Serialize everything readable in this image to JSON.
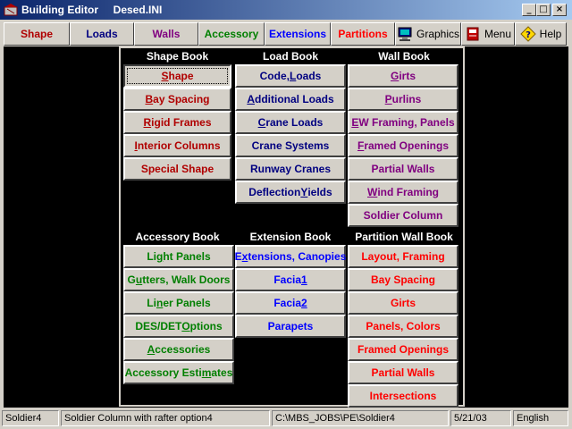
{
  "window": {
    "app_title": "Building Editor",
    "document": "Desed.INI",
    "controls": {
      "minimize": "_",
      "maximize": "□",
      "close": "×"
    }
  },
  "toolbar": {
    "tabs": [
      {
        "label": "Shape",
        "color": "#b00000"
      },
      {
        "label": "Loads",
        "color": "#000080"
      },
      {
        "label": "Walls",
        "color": "#800080"
      },
      {
        "label": "Accessory",
        "color": "#007f00"
      },
      {
        "label": "Extensions",
        "color": "#0000ff"
      },
      {
        "label": "Partitions",
        "color": "#ff0000"
      },
      {
        "label": "Graphics",
        "icon": "monitor-icon"
      },
      {
        "label": "Menu",
        "icon": "book-icon"
      },
      {
        "label": "Help",
        "icon": "help-icon"
      }
    ]
  },
  "books": {
    "shape": {
      "title": "Shape Book",
      "items": [
        {
          "pre": "",
          "key": "S",
          "post": "hape"
        },
        {
          "pre": "",
          "key": "B",
          "post": "ay Spacing"
        },
        {
          "pre": "",
          "key": "R",
          "post": "igid Frames"
        },
        {
          "pre": "",
          "key": "I",
          "post": "nterior Columns"
        },
        {
          "pre": "Special Shape",
          "key": "",
          "post": ""
        }
      ]
    },
    "load": {
      "title": "Load Book",
      "items": [
        {
          "pre": "Code, ",
          "key": "L",
          "post": "oads"
        },
        {
          "pre": "",
          "key": "A",
          "post": "dditional Loads"
        },
        {
          "pre": "",
          "key": "C",
          "post": "rane Loads"
        },
        {
          "pre": "Crane Systems",
          "key": "",
          "post": ""
        },
        {
          "pre": "Runway Cranes",
          "key": "",
          "post": ""
        },
        {
          "pre": "Deflection ",
          "key": "Y",
          "post": "ields"
        }
      ]
    },
    "wall": {
      "title": "Wall Book",
      "items": [
        {
          "pre": "",
          "key": "G",
          "post": "irts"
        },
        {
          "pre": "",
          "key": "P",
          "post": "urlins"
        },
        {
          "pre": "",
          "key": "E",
          "post": "W Framing, Panels"
        },
        {
          "pre": "",
          "key": "F",
          "post": "ramed Openings"
        },
        {
          "pre": "Partial Walls",
          "key": "",
          "post": ""
        },
        {
          "pre": "",
          "key": "W",
          "post": "ind Framing"
        },
        {
          "pre": "Soldier Column",
          "key": "",
          "post": ""
        }
      ]
    },
    "accessory": {
      "title": "Accessory Book",
      "items": [
        {
          "pre": "Li",
          "key": "g",
          "post": "ht Panels"
        },
        {
          "pre": "G",
          "key": "u",
          "post": "tters, Walk Doors"
        },
        {
          "pre": "Li",
          "key": "n",
          "post": "er Panels"
        },
        {
          "pre": "DES/DET ",
          "key": "O",
          "post": "ptions"
        },
        {
          "pre": "",
          "key": "A",
          "post": "ccessories"
        },
        {
          "pre": "Accessory Esti",
          "key": "m",
          "post": "ates"
        }
      ]
    },
    "extension": {
      "title": "Extension Book",
      "items": [
        {
          "pre": "E",
          "key": "x",
          "post": "tensions, Canopies"
        },
        {
          "pre": "Facia ",
          "key": "1",
          "post": ""
        },
        {
          "pre": "Facia ",
          "key": "2",
          "post": ""
        },
        {
          "pre": "Parapets",
          "key": "",
          "post": ""
        }
      ]
    },
    "partition": {
      "title": "Partition Wall Book",
      "items": [
        {
          "pre": "Layout, Framing",
          "key": "",
          "post": ""
        },
        {
          "pre": "Bay Spacing",
          "key": "",
          "post": ""
        },
        {
          "pre": "Girts",
          "key": "",
          "post": ""
        },
        {
          "pre": "Panels, Colors",
          "key": "",
          "post": ""
        },
        {
          "pre": "Framed Openings",
          "key": "",
          "post": ""
        },
        {
          "pre": "Partial Walls",
          "key": "",
          "post": ""
        },
        {
          "pre": "Intersections",
          "key": "",
          "post": ""
        }
      ]
    }
  },
  "statusbar": {
    "panel1": "Soldier4",
    "panel2": "Soldier Column with rafter option4",
    "panel3": "C:\\MBS_JOBS\\PE\\Soldier4",
    "panel4": "5/21/03",
    "panel5": "English"
  },
  "colors": {
    "shape": "#b00000",
    "load": "#000080",
    "wall": "#800080",
    "accessory": "#007f00",
    "extension": "#0000ff",
    "partition": "#ff0000"
  }
}
